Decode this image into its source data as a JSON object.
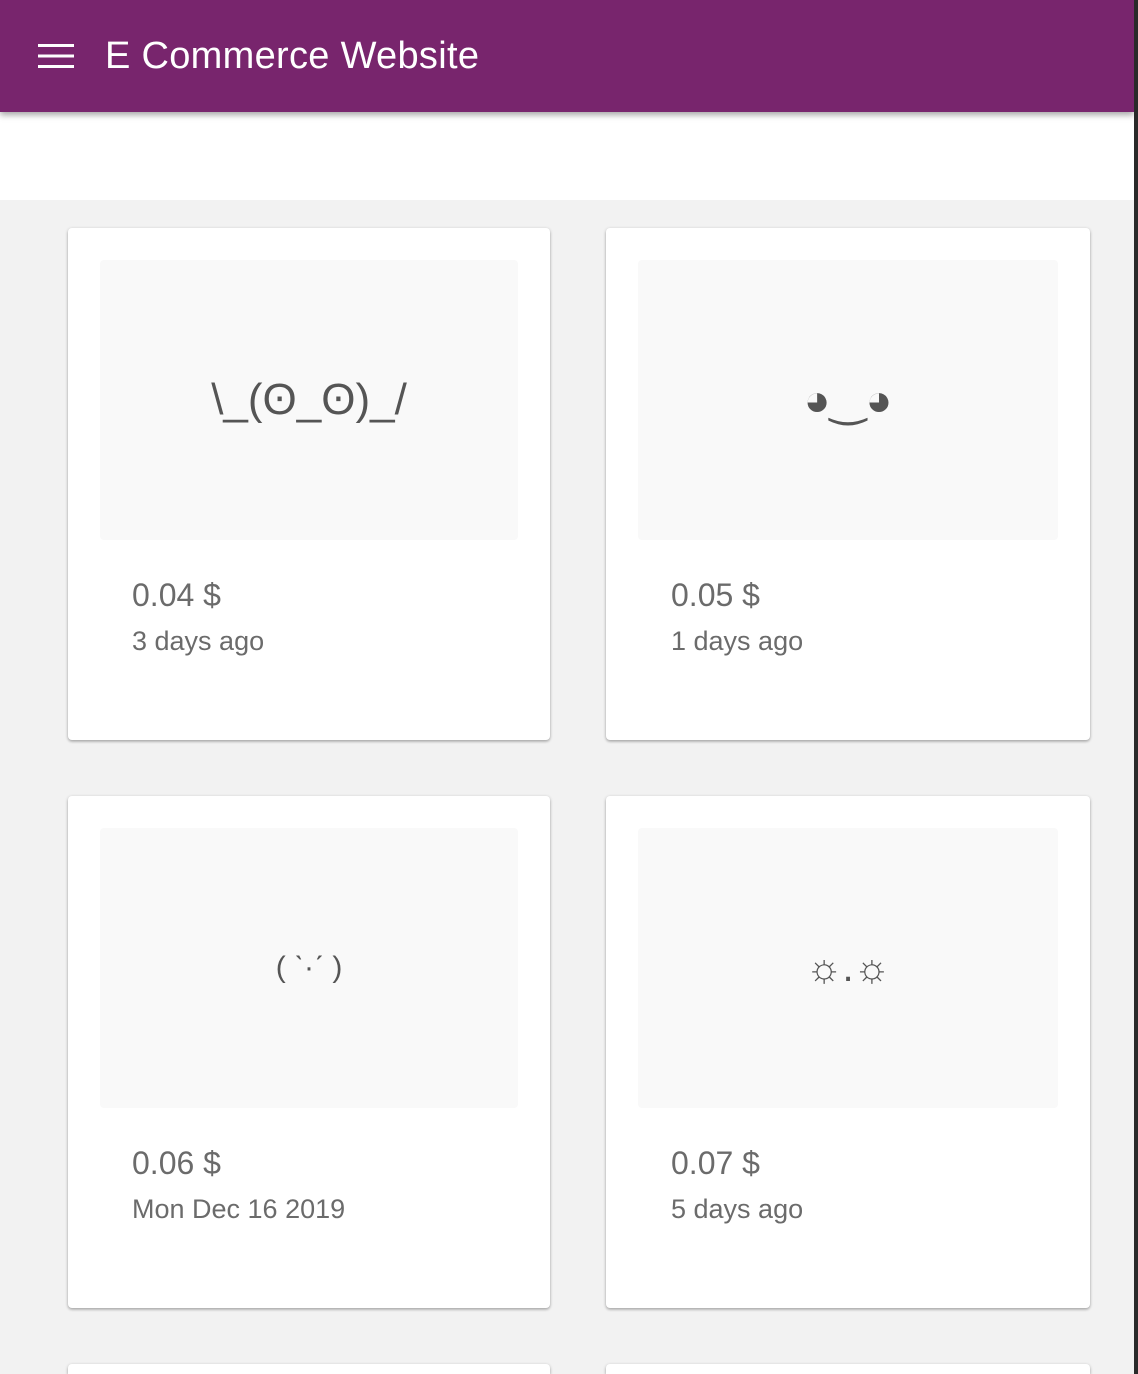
{
  "header": {
    "title": "E Commerce Website",
    "menu_icon": "hamburger-menu-icon",
    "background": "#78256d"
  },
  "products": [
    {
      "face": "\\_(ʘ_ʘ)_/",
      "price": "0.04 $",
      "date": "3 days ago"
    },
    {
      "face": "◕‿◕",
      "price": "0.05 $",
      "date": "1 days ago"
    },
    {
      "face": "( ˋ·ˊ )",
      "price": "0.06 $",
      "date": "Mon Dec 16 2019"
    },
    {
      "face": "☼.☼",
      "price": "0.07 $",
      "date": "5 days ago"
    }
  ]
}
